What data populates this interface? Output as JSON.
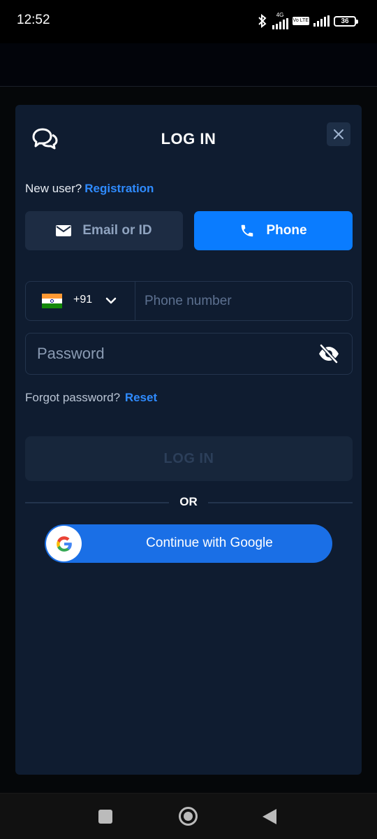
{
  "status_bar": {
    "time": "12:52",
    "network_label": "4G",
    "volte_label": "Vo LTE",
    "battery": "36"
  },
  "modal": {
    "title": "LOG IN",
    "close_icon": "close-icon",
    "chat_icon": "chat-bubbles-icon",
    "new_user_text": "New user?",
    "registration_link": "Registration",
    "tabs": [
      {
        "label": "Email or ID",
        "icon": "mail-icon",
        "active": false
      },
      {
        "label": "Phone",
        "icon": "phone-icon",
        "active": true
      }
    ],
    "country_code": "+91",
    "country_flag": "india-flag",
    "phone_placeholder": "Phone number",
    "password_placeholder": "Password",
    "forgot_text": "Forgot password?",
    "reset_link": "Reset",
    "login_button": "LOG IN",
    "or_text": "OR",
    "google_button": "Continue with Google"
  },
  "colors": {
    "modal_bg": "#0f1c30",
    "accent": "#0a7cff",
    "link": "#2f8bff",
    "google_button": "#1a6fe6"
  }
}
